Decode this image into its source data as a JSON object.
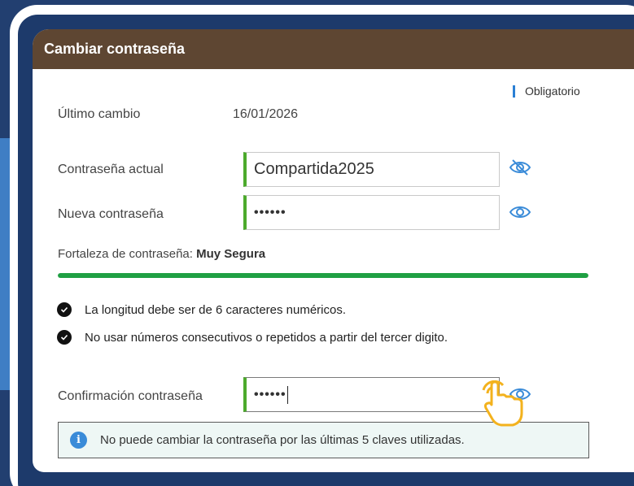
{
  "card": {
    "title": "Cambiar contraseña",
    "required_note": "Obligatorio"
  },
  "last_change": {
    "label": "Último cambio",
    "value": "16/01/2026"
  },
  "current_password": {
    "label": "Contraseña actual",
    "value": "Compartida2025",
    "eye_icon": "eye-slash-icon"
  },
  "new_password": {
    "label": "Nueva contraseña",
    "value": "••••••",
    "eye_icon": "eye-icon"
  },
  "strength": {
    "label": "Fortaleza de contraseña:",
    "value": "Muy Segura",
    "fill_fraction": 1.0,
    "color": "#1fa043"
  },
  "rules": [
    {
      "text": "La longitud debe ser de 6 caracteres numéricos.",
      "icon": "check-circle-icon"
    },
    {
      "text": "No usar números consecutivos o repetidos a partir del tercer digito.",
      "icon": "check-circle-icon"
    }
  ],
  "confirm_password": {
    "label": "Confirmación contraseña",
    "value": "••••••",
    "eye_icon": "eye-icon"
  },
  "info": {
    "text": "No puede cambiar la contraseña por las últimas 5 claves utilizadas.",
    "icon": "info-icon"
  },
  "colors": {
    "header": "#5e4632",
    "accent_green": "#4caa2c",
    "accent_blue": "#2a7fd4"
  }
}
